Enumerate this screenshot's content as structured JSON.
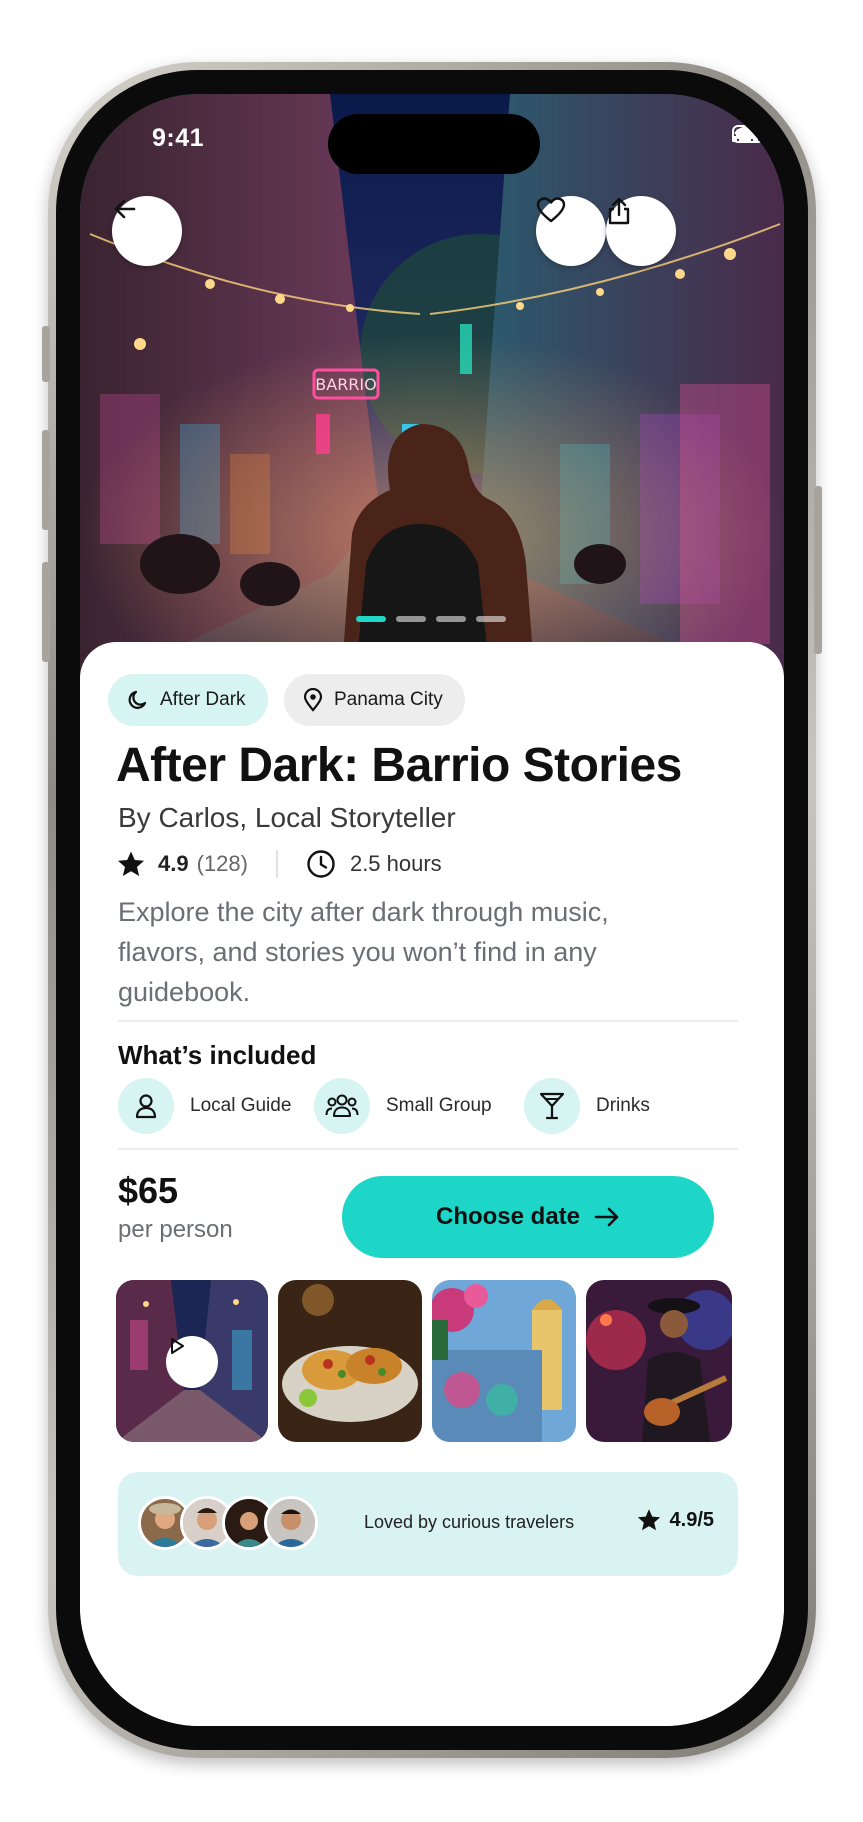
{
  "status_bar": {
    "time": "9:41"
  },
  "hero": {
    "neon_sign": "BARRIO",
    "carousel_pages": 4,
    "carousel_active": 1
  },
  "tags": [
    {
      "label": "After Dark",
      "icon": "moon-icon"
    },
    {
      "label": "Panama City",
      "icon": "location-pin-icon"
    }
  ],
  "experience": {
    "title": "After Dark: Barrio Stories",
    "byline": "By Carlos, Local Storyteller",
    "rating": "4.9",
    "reviews": "(128)",
    "duration": "2.5 hours",
    "description": "Explore the city after dark through music, flavors, and stories you won’t find in any guidebook."
  },
  "included": {
    "title": "What’s included",
    "items": [
      {
        "label": "Local Guide",
        "icon": "guide-icon"
      },
      {
        "label": "Small Group",
        "icon": "group-icon"
      },
      {
        "label": "Drinks",
        "icon": "cocktail-icon"
      }
    ]
  },
  "booking": {
    "price": "$65",
    "unit": "per person",
    "cta": "Choose date"
  },
  "gallery": [
    {
      "name": "video-alley-night",
      "has_play": true
    },
    {
      "name": "tacos-plate",
      "has_play": false
    },
    {
      "name": "colonial-church-mural",
      "has_play": false
    },
    {
      "name": "guitarist-neon",
      "has_play": false
    }
  ],
  "social_proof": {
    "text": "Loved by curious travelers",
    "rating": "4.9/5"
  },
  "colors": {
    "accent": "#1dd6c8",
    "accent_light": "#d6f4f1",
    "text": "#111111",
    "muted": "#6b6e75"
  }
}
